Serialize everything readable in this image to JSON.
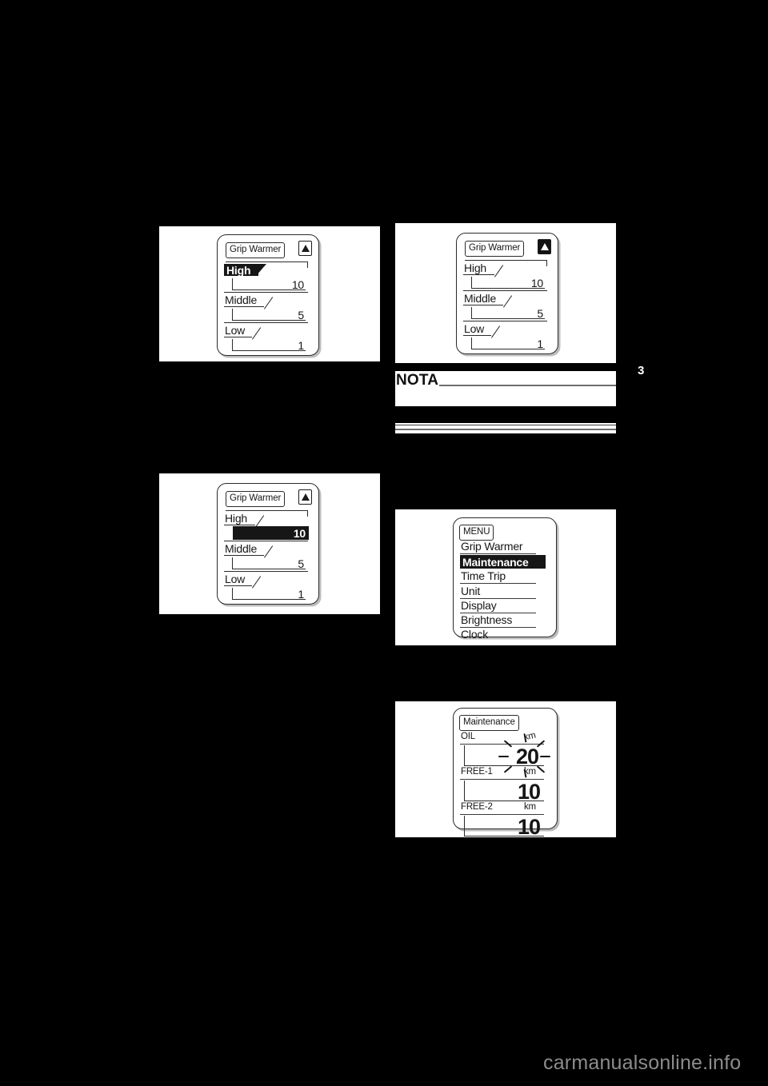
{
  "page": {
    "number": "3",
    "watermark": "carmanualsonline.info",
    "background": "#000000",
    "accent": "#161616"
  },
  "figures": [
    {
      "id": "grip-warmer-high-selected",
      "title": "Grip Warmer",
      "indicator_icon": "up-triangle-icon",
      "indicator_state": "outline",
      "rows": [
        {
          "label": "High",
          "value": "10",
          "label_highlighted": true,
          "value_highlighted": false
        },
        {
          "label": "Middle",
          "value": "5",
          "label_highlighted": false,
          "value_highlighted": false
        },
        {
          "label": "Low",
          "value": "1",
          "label_highlighted": false,
          "value_highlighted": false
        }
      ]
    },
    {
      "id": "grip-warmer-value-selected",
      "title": "Grip Warmer",
      "indicator_icon": "up-triangle-icon",
      "indicator_state": "outline",
      "rows": [
        {
          "label": "High",
          "value": "10",
          "label_highlighted": false,
          "value_highlighted": true
        },
        {
          "label": "Middle",
          "value": "5",
          "label_highlighted": false,
          "value_highlighted": false
        },
        {
          "label": "Low",
          "value": "1",
          "label_highlighted": false,
          "value_highlighted": false
        }
      ]
    },
    {
      "id": "grip-warmer-confirmed",
      "title": "Grip Warmer",
      "indicator_icon": "up-triangle-icon",
      "indicator_state": "inverted",
      "rows": [
        {
          "label": "High",
          "value": "10",
          "label_highlighted": false,
          "value_highlighted": false
        },
        {
          "label": "Middle",
          "value": "5",
          "label_highlighted": false,
          "value_highlighted": false
        },
        {
          "label": "Low",
          "value": "1",
          "label_highlighted": false,
          "value_highlighted": false
        }
      ]
    }
  ],
  "menu_figure": {
    "id": "menu-maintenance-selected",
    "title": "MENU",
    "items": [
      {
        "label": "Grip Warmer",
        "selected": false
      },
      {
        "label": "Maintenance",
        "selected": true
      },
      {
        "label": "Time Trip",
        "selected": false
      },
      {
        "label": "Unit",
        "selected": false
      },
      {
        "label": "Display",
        "selected": false
      },
      {
        "label": "Brightness",
        "selected": false
      },
      {
        "label": "Clock",
        "selected": false
      }
    ]
  },
  "maintenance_figure": {
    "id": "maintenance-oil-blinking",
    "title": "Maintenance",
    "rows": [
      {
        "label": "OIL",
        "unit": "km",
        "value": "20",
        "blinking": true
      },
      {
        "label": "FREE-1",
        "unit": "km",
        "value": "10",
        "blinking": false
      },
      {
        "label": "FREE-2",
        "unit": "km",
        "value": "10",
        "blinking": false
      }
    ]
  },
  "note": {
    "heading": "NOTA",
    "body": ""
  }
}
